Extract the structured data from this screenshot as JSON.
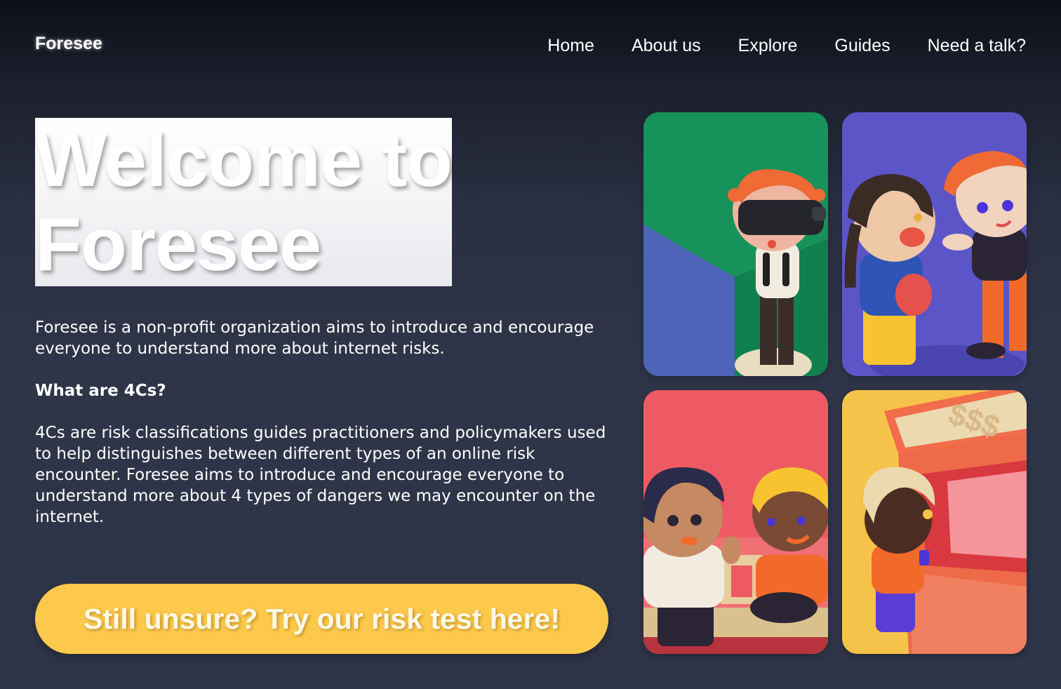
{
  "nav": {
    "logo": "Foresee",
    "links": [
      "Home",
      "About us",
      "Explore",
      "Guides",
      "Need a talk?"
    ]
  },
  "hero": {
    "title_line1": "Welcome to",
    "title_line2": "Foresee"
  },
  "content": {
    "intro": "Foresee is a non-profit organization aims to introduce and encourage everyone to understand more about internet risks.",
    "subhead": "What are 4Cs?",
    "body": "4Cs are risk classifications guides practitioners and policymakers used to help distinguishes between different types of an online risk encounter. Foresee aims to introduce and encourage everyone to understand more about 4 types of dangers we may encounter on the internet."
  },
  "cta": {
    "label": "Still unsure? Try our risk test here!"
  },
  "illustrations": {
    "card4_sign": "$$$"
  },
  "colors": {
    "background": "#2f3548",
    "nav_background": "#0d0f16",
    "cta": "#fdc94c",
    "card_green": "#16925a",
    "card_purple": "#5b55c8",
    "card_red": "#ee5a63",
    "card_yellow": "#f6c34a"
  }
}
